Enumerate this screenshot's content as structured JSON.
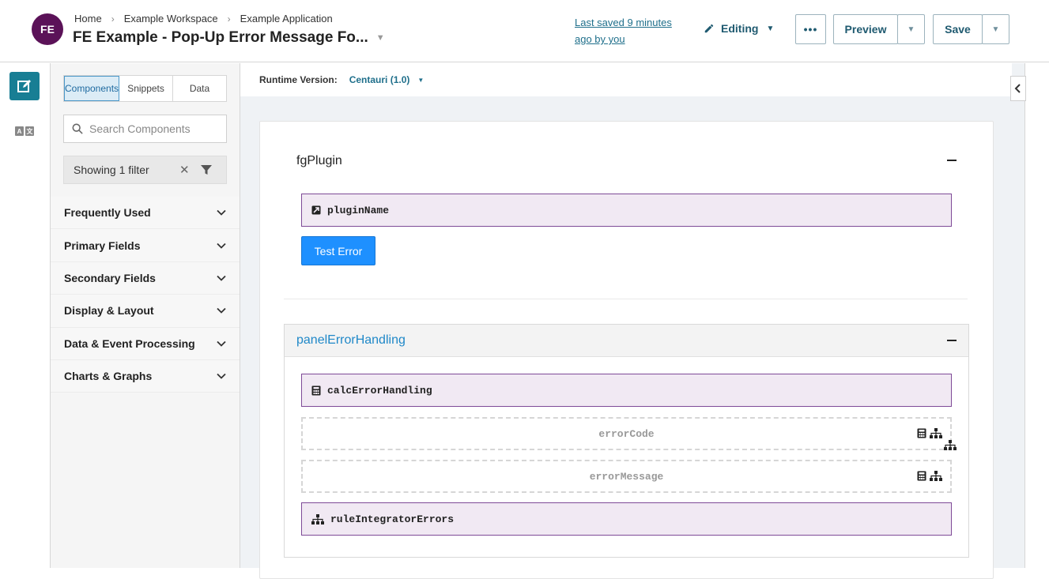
{
  "header": {
    "avatar": "FE",
    "breadcrumb": [
      "Home",
      "Example Workspace",
      "Example Application"
    ],
    "title": "FE Example - Pop-Up Error Message Fo...",
    "last_saved_line1": "Last saved 9 minutes",
    "last_saved_line2": "ago by you",
    "editing_label": "Editing",
    "more_label": "•••",
    "preview_label": "Preview",
    "save_label": "Save"
  },
  "sidebar": {
    "tabs": [
      "Components",
      "Snippets",
      "Data"
    ],
    "active_tab": "Components",
    "search_placeholder": "Search Components",
    "filter_label": "Showing 1 filter",
    "categories": [
      "Frequently Used",
      "Primary Fields",
      "Secondary Fields",
      "Display & Layout",
      "Data & Event Processing",
      "Charts & Graphs"
    ]
  },
  "main": {
    "runtime_label": "Runtime Version:",
    "runtime_value": "Centauri (1.0)",
    "section_title": "fgPlugin",
    "plugin_field": "pluginName",
    "test_button": "Test Error",
    "panel_title": "panelErrorHandling",
    "calc_field": "calcErrorHandling",
    "ghost_fields": [
      "errorCode",
      "errorMessage"
    ],
    "rule_field": "ruleIntegratorErrors"
  },
  "colors": {
    "avatar": "#5b1258",
    "accent": "#187e94",
    "field_border": "#7e4a97",
    "field_bg": "#f1e9f3",
    "button_blue": "#1e90ff",
    "panel_title": "#1f88c8"
  }
}
